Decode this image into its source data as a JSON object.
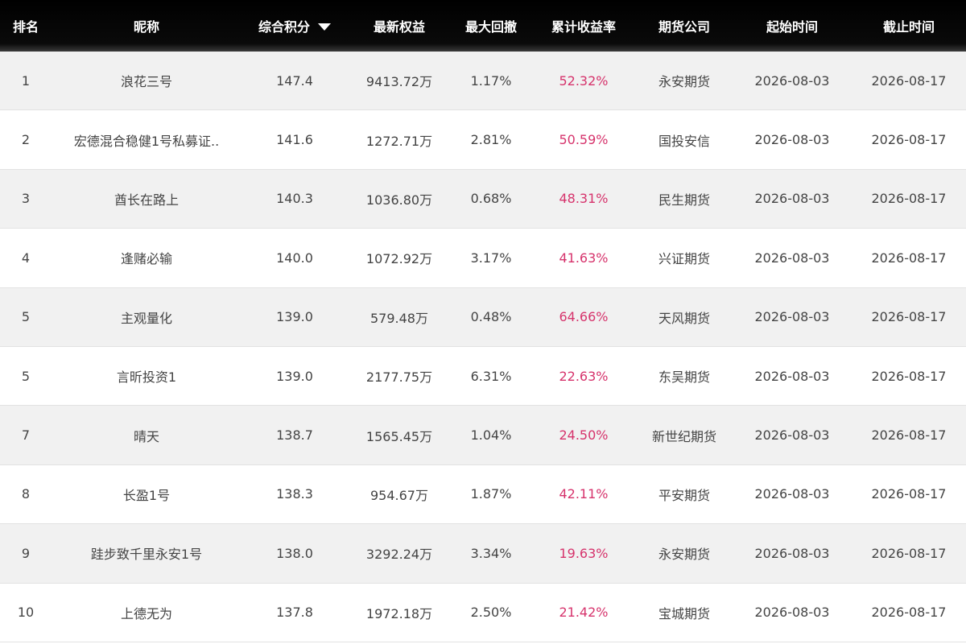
{
  "header": {
    "rank": "排名",
    "name": "昵称",
    "score": "综合积分",
    "sort_icon": "sort-down-icon",
    "equity": "最新权益",
    "drawdown": "最大回撤",
    "return": "累计收益率",
    "company": "期货公司",
    "start": "起始时间",
    "end": "截止时间"
  },
  "colors": {
    "header_bg": "#000000",
    "return_color": "#d6336c",
    "row_alt": "#f1f1f1"
  },
  "rows": [
    {
      "rank": "1",
      "name": "浪花三号",
      "score": "147.4",
      "equity": "9413.72万",
      "drawdown": "1.17%",
      "return": "52.32%",
      "company": "永安期货",
      "start": "2026-08-03",
      "end": "2026-08-17"
    },
    {
      "rank": "2",
      "name": "宏德混合稳健1号私募证..",
      "score": "141.6",
      "equity": "1272.71万",
      "drawdown": "2.81%",
      "return": "50.59%",
      "company": "国投安信",
      "start": "2026-08-03",
      "end": "2026-08-17"
    },
    {
      "rank": "3",
      "name": "酋长在路上",
      "score": "140.3",
      "equity": "1036.80万",
      "drawdown": "0.68%",
      "return": "48.31%",
      "company": "民生期货",
      "start": "2026-08-03",
      "end": "2026-08-17"
    },
    {
      "rank": "4",
      "name": "逢赌必输",
      "score": "140.0",
      "equity": "1072.92万",
      "drawdown": "3.17%",
      "return": "41.63%",
      "company": "兴证期货",
      "start": "2026-08-03",
      "end": "2026-08-17"
    },
    {
      "rank": "5",
      "name": "主观量化",
      "score": "139.0",
      "equity": "579.48万",
      "drawdown": "0.48%",
      "return": "64.66%",
      "company": "天风期货",
      "start": "2026-08-03",
      "end": "2026-08-17"
    },
    {
      "rank": "5",
      "name": "言昕投资1",
      "score": "139.0",
      "equity": "2177.75万",
      "drawdown": "6.31%",
      "return": "22.63%",
      "company": "东吴期货",
      "start": "2026-08-03",
      "end": "2026-08-17"
    },
    {
      "rank": "7",
      "name": "晴天",
      "score": "138.7",
      "equity": "1565.45万",
      "drawdown": "1.04%",
      "return": "24.50%",
      "company": "新世纪期货",
      "start": "2026-08-03",
      "end": "2026-08-17"
    },
    {
      "rank": "8",
      "name": "长盈1号",
      "score": "138.3",
      "equity": "954.67万",
      "drawdown": "1.87%",
      "return": "42.11%",
      "company": "平安期货",
      "start": "2026-08-03",
      "end": "2026-08-17"
    },
    {
      "rank": "9",
      "name": "跬步致千里永安1号",
      "score": "138.0",
      "equity": "3292.24万",
      "drawdown": "3.34%",
      "return": "19.63%",
      "company": "永安期货",
      "start": "2026-08-03",
      "end": "2026-08-17"
    },
    {
      "rank": "10",
      "name": "上德无为",
      "score": "137.8",
      "equity": "1972.18万",
      "drawdown": "2.50%",
      "return": "21.42%",
      "company": "宝城期货",
      "start": "2026-08-03",
      "end": "2026-08-17"
    }
  ]
}
